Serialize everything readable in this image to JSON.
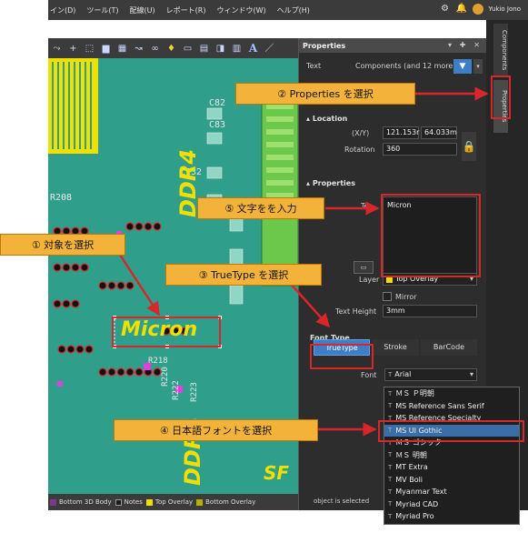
{
  "menubar": {
    "items": [
      "イン(D)",
      "ツール(T)",
      "配線(U)",
      "レポート(R)",
      "ウィンドウ(W)",
      "ヘルプ(H)"
    ],
    "username": "Yukio Jono"
  },
  "toolbar": {
    "text_tool": "A"
  },
  "pcb": {
    "labels": [
      "C82",
      "C83",
      "C132",
      "R208",
      "DDR4",
      "DDR4",
      "R218",
      "R220",
      "R222",
      "R223",
      "SF"
    ],
    "selected_text": "Micron"
  },
  "layers": [
    {
      "name": "Bottom 3D Body",
      "color": "#7a3a8c"
    },
    {
      "name": "Notes",
      "color": "#1a1a1a"
    },
    {
      "name": "Top Overlay",
      "color": "#f0e000"
    },
    {
      "name": "Bottom Overlay",
      "color": "#b8b000"
    }
  ],
  "properties": {
    "title": "Properties",
    "header_controls": "▾ ✚ ✕",
    "type_label": "Text",
    "filter_summary": "Components (and 12 more)",
    "location": {
      "section": "Location",
      "xy_label": "(X/Y)",
      "x": "121.153r",
      "y": "64.033m",
      "rotation_label": "Rotation",
      "rotation": "360"
    },
    "props": {
      "section": "Properties",
      "text_label": "Te",
      "text_value": "Micron",
      "layer_label": "Layer",
      "layer_value": "Top Overlay",
      "mirror_label": "Mirror",
      "height_label": "Text Height",
      "height_value": "3mm"
    },
    "font_type": {
      "section": "Font Type",
      "options": [
        "TrueType",
        "Stroke",
        "BarCode"
      ],
      "selected": "TrueType",
      "font_label": "Font",
      "font_value": "Arial"
    },
    "status": "object is selected"
  },
  "side_tabs": [
    "Components",
    "Properties"
  ],
  "font_list": [
    "ＭＳ Ｐ明朝",
    "MS Reference Sans Serif",
    "MS Reference Specialty",
    "MS UI Gothic",
    "ＭＳ ゴシック",
    "ＭＳ 明朝",
    "MT Extra",
    "MV Boli",
    "Myanmar Text",
    "Myriad CAD",
    "Myriad Pro"
  ],
  "font_list_selected": "MS UI Gothic",
  "tt_glyph": "T",
  "callouts": {
    "c1": "① 対象を選択",
    "c2": "② Properties を選択",
    "c3": "③ TrueType を選択",
    "c4": "④ 日本語フォントを選択",
    "c5": "⑤ 文字をを入力"
  },
  "accent": {
    "callout": "#f3b23a",
    "redbox": "#d8262b",
    "pcb": "#2f9f8c",
    "silk": "#f0e000"
  }
}
